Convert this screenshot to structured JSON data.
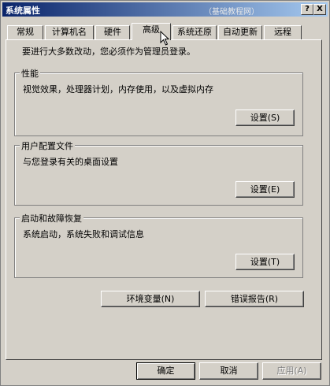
{
  "window": {
    "title": "系统属性",
    "watermark": "（基础教程网）",
    "help_button": "?",
    "close_button": "X"
  },
  "tabs": [
    {
      "label": "常规"
    },
    {
      "label": "计算机名"
    },
    {
      "label": "硬件"
    },
    {
      "label": "高级",
      "selected": true
    },
    {
      "label": "系统还原"
    },
    {
      "label": "自动更新"
    },
    {
      "label": "远程"
    }
  ],
  "advanced": {
    "admin_note": "要进行大多数改动，您必须作为管理员登录。",
    "performance": {
      "legend": "性能",
      "description": "视觉效果，处理器计划，内存使用，以及虚拟内存",
      "button": "设置(S)"
    },
    "user_profiles": {
      "legend": "用户配置文件",
      "description": "与您登录有关的桌面设置",
      "button": "设置(E)"
    },
    "startup_recovery": {
      "legend": "启动和故障恢复",
      "description": "系统启动，系统失败和调试信息",
      "button": "设置(T)"
    },
    "env_vars_button": "环境变量(N)",
    "error_report_button": "错误报告(R)"
  },
  "footer": {
    "ok": "确定",
    "cancel": "取消",
    "apply": "应用(A)"
  }
}
